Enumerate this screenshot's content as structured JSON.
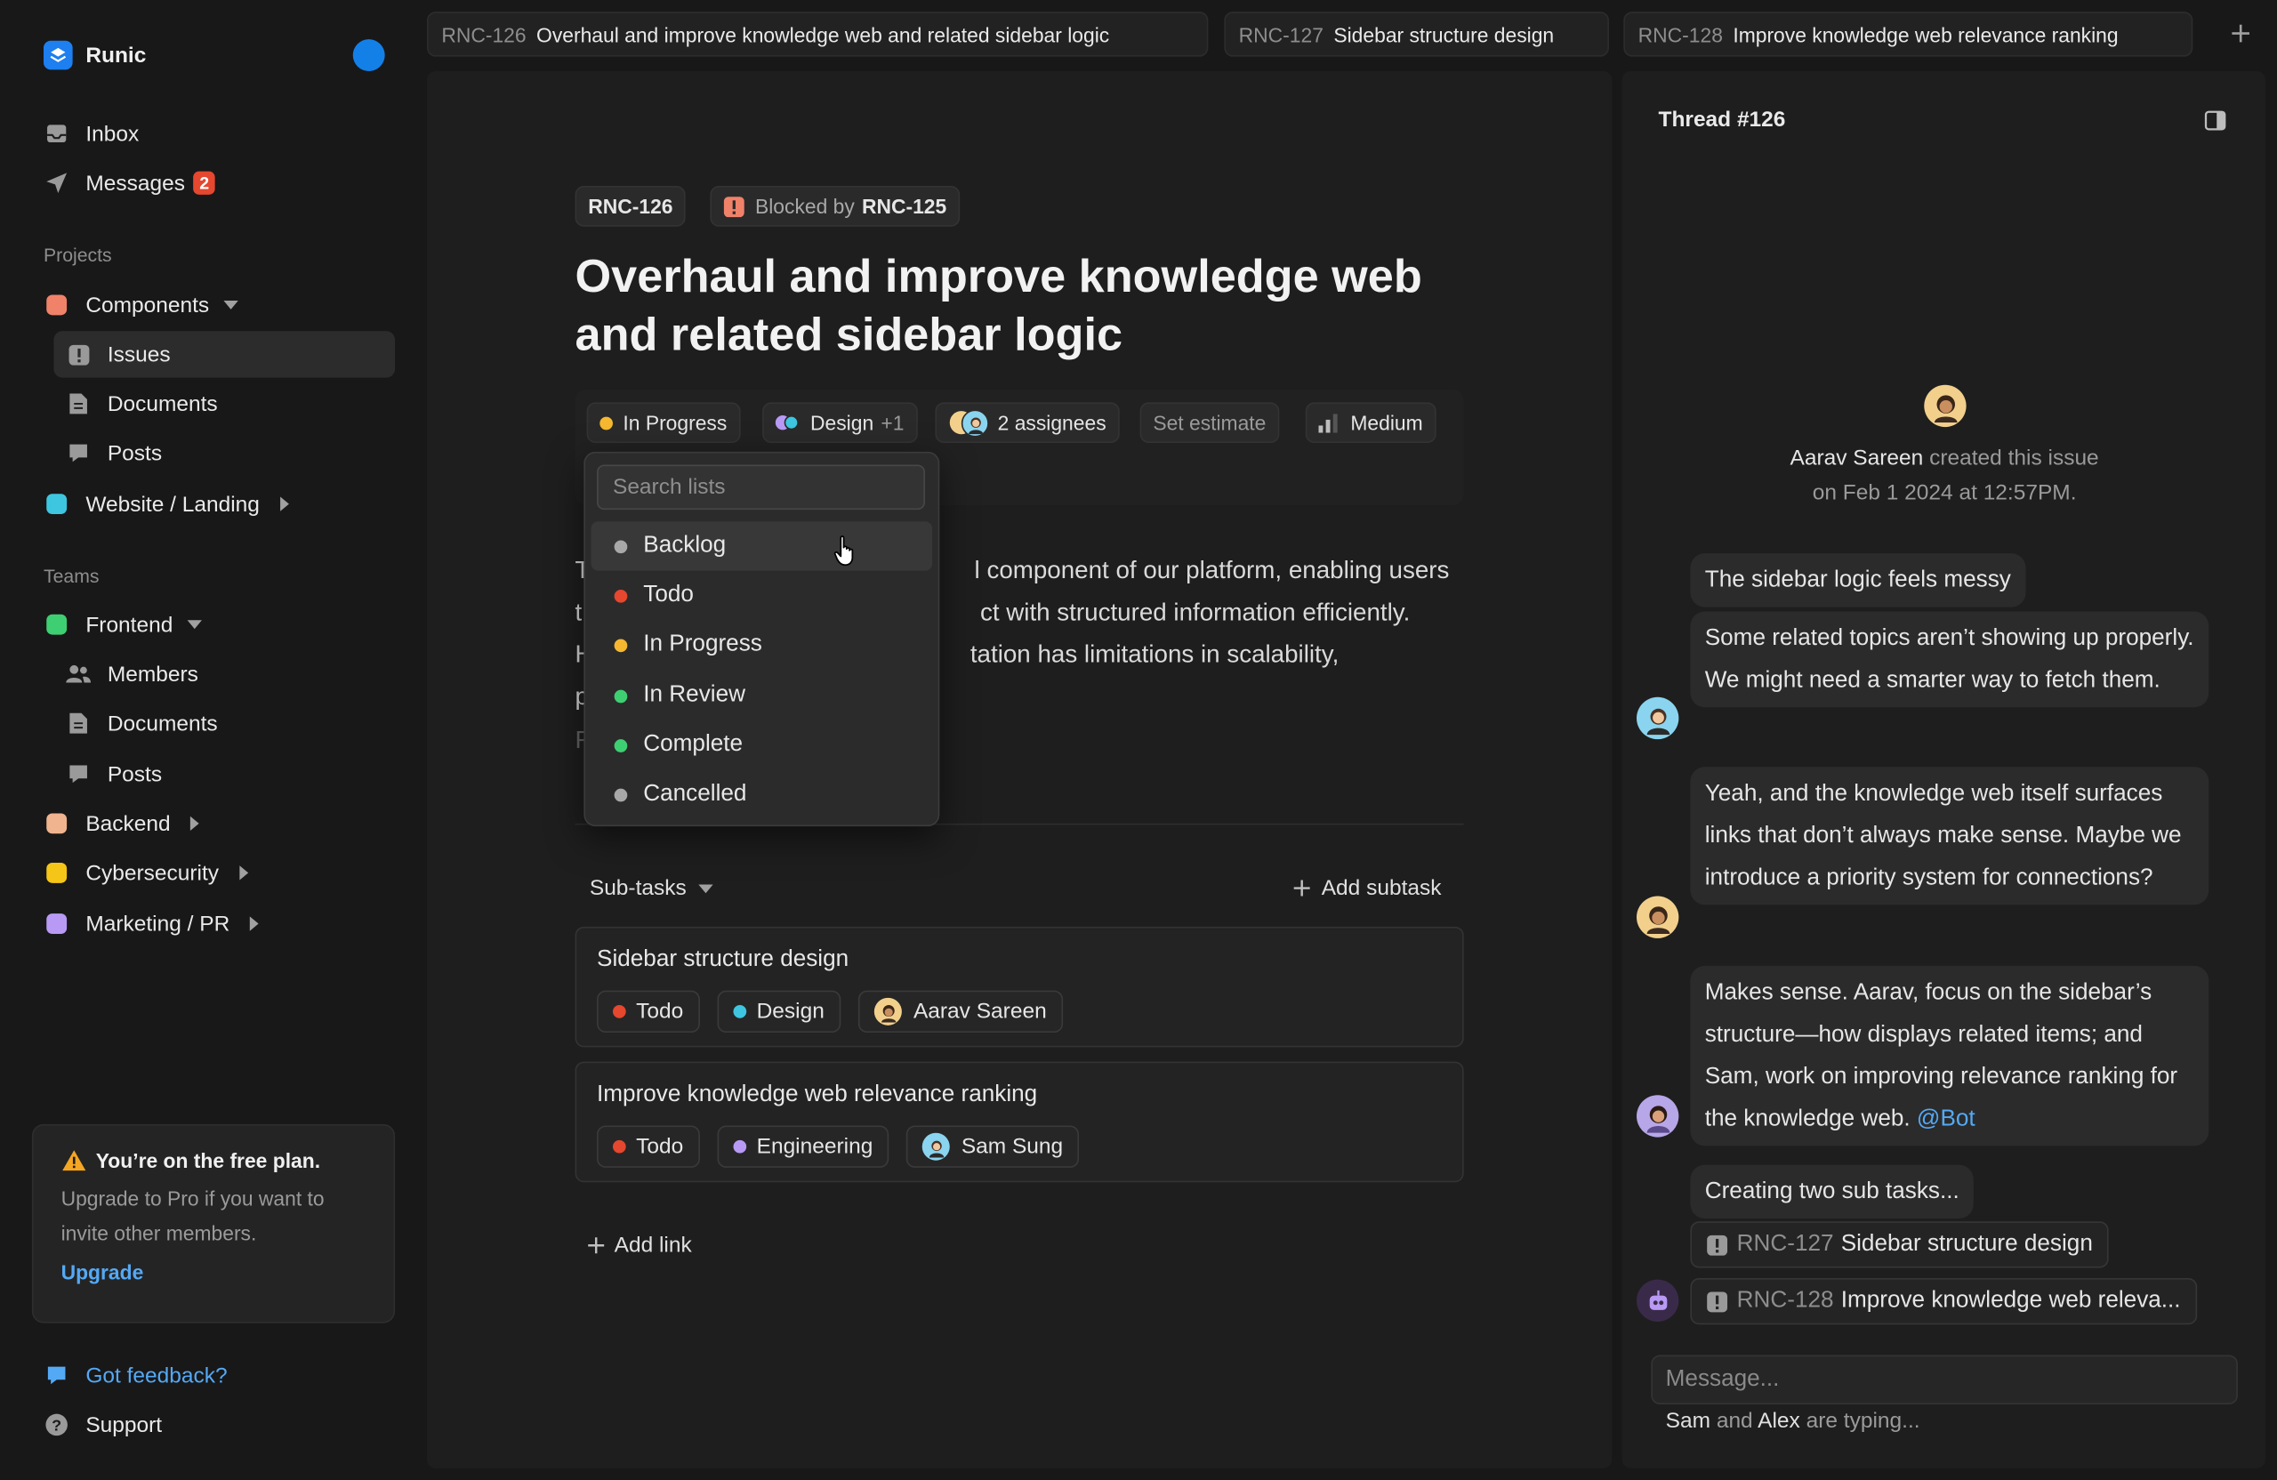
{
  "brand": {
    "name": "Runic"
  },
  "sidebar": {
    "inbox": "Inbox",
    "messages": {
      "label": "Messages",
      "badge": "2"
    },
    "projects_heading": "Projects",
    "components": "Components",
    "issues": "Issues",
    "documents": "Documents",
    "posts": "Posts",
    "website": "Website / Landing",
    "teams_heading": "Teams",
    "frontend": "Frontend",
    "members": "Members",
    "team_documents": "Documents",
    "team_posts": "Posts",
    "backend": "Backend",
    "cybersecurity": "Cybersecurity",
    "marketing": "Marketing / PR",
    "colors": {
      "components": "#f0826a",
      "website": "#3ec6e0",
      "frontend": "#3ecf72",
      "backend": "#f0b48e",
      "cybersecurity": "#f5c518",
      "marketing": "#b89af5"
    }
  },
  "plan": {
    "title": "You’re on the free plan.",
    "text": "Upgrade to Pro if you want to invite other members.",
    "link": "Upgrade"
  },
  "footer": {
    "feedback": "Got feedback?",
    "support": "Support"
  },
  "tabs": [
    {
      "key": "RNC-126",
      "title": "Overhaul and improve knowledge web and related sidebar logic"
    },
    {
      "key": "RNC-127",
      "title": "Sidebar structure design"
    },
    {
      "key": "RNC-128",
      "title": "Improve knowledge web relevance ranking"
    }
  ],
  "issue": {
    "id": "RNC-126",
    "blocked_prefix": "Blocked by",
    "blocked_by": "RNC-125",
    "title": "Overhaul and improve knowledge web and related sidebar logic",
    "status": "In Progress",
    "label": "Design",
    "label_extra": "+1",
    "assignees": "2 assignees",
    "estimate": "Set estimate",
    "priority": "Medium",
    "description": [
      {
        "left": "T",
        "right": "l component of our platform, enabling users"
      },
      {
        "left": "t",
        "right": "ct with structured information efficiently."
      },
      {
        "left": "H",
        "right": "tation has limitations in scalability,"
      },
      {
        "left": "p",
        "right": ""
      }
    ],
    "placeholder_fragment": "F"
  },
  "dropdown": {
    "search_placeholder": "Search lists",
    "items": [
      {
        "label": "Backlog",
        "color": "#a8a8a8"
      },
      {
        "label": "Todo",
        "color": "#e5472f"
      },
      {
        "label": "In Progress",
        "color": "#f5b830"
      },
      {
        "label": "In Review",
        "color": "#3ecf72"
      },
      {
        "label": "Complete",
        "color": "#3ecf72"
      },
      {
        "label": "Cancelled",
        "color": "#a8a8a8"
      }
    ]
  },
  "subtasks": {
    "heading": "Sub-tasks",
    "add": "Add subtask",
    "items": [
      {
        "title": "Sidebar structure design",
        "status": "Todo",
        "label": "Design",
        "assignee": "Aarav Sareen"
      },
      {
        "title": "Improve knowledge web relevance ranking",
        "status": "Todo",
        "label": "Engineering",
        "assignee": "Sam Sung"
      }
    ],
    "add_link": "Add link"
  },
  "thread": {
    "title": "Thread #126",
    "creator": "Aarav Sareen",
    "created_text": "created this issue",
    "created_date": "on Feb 1 2024 at 12:57PM.",
    "messages": [
      "The sidebar logic feels messy",
      "Some related topics aren’t showing up properly. We might need a smarter way to fetch them.",
      "Yeah, and the knowledge web itself surfaces links that don’t always make sense. Maybe we introduce a priority system for connections?",
      "Makes sense. Aarav, focus on the sidebar’s structure—how displays related items; and Sam, work on improving relevance ranking for the knowledge web.",
      "Creating two sub tasks..."
    ],
    "mention": "@Bot",
    "refs": [
      {
        "key": "RNC-127",
        "title": "Sidebar structure design"
      },
      {
        "key": "RNC-128",
        "title": "Improve knowledge web releva..."
      }
    ],
    "input_placeholder": "Message...",
    "typing_name1": "Sam",
    "typing_and": "and",
    "typing_name2": "Alex",
    "typing_suffix": "are typing..."
  }
}
